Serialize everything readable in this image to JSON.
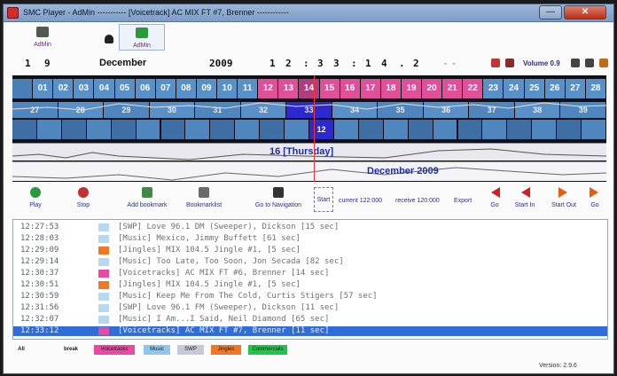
{
  "window": {
    "title": "SMC Player - AdMin ----------- [Voicetrack] AC MIX FT #7, Brenner ------------",
    "close_label": "✕",
    "minimize_label": "—"
  },
  "tabs": [
    {
      "label": "AdMin",
      "active": false
    },
    {
      "label": "AdMin",
      "active": true
    }
  ],
  "datetime": {
    "day": "1",
    "dayb": "9",
    "month": "December",
    "year": "2009",
    "time_parts": [
      "1",
      "2",
      ":",
      "3",
      "3",
      ":",
      "1",
      "4",
      ".",
      "2"
    ],
    "dashes": "- -",
    "volume_label": "Volume 0.9"
  },
  "timeline": {
    "days": [
      {
        "n": "",
        "color": "#4a7fb5"
      },
      {
        "n": "01",
        "color": "#5a90c8"
      },
      {
        "n": "02",
        "color": "#5a90c8"
      },
      {
        "n": "03",
        "color": "#5a90c8"
      },
      {
        "n": "04",
        "color": "#5a90c8"
      },
      {
        "n": "05",
        "color": "#5a90c8"
      },
      {
        "n": "06",
        "color": "#5a90c8"
      },
      {
        "n": "07",
        "color": "#5a90c8"
      },
      {
        "n": "08",
        "color": "#5a90c8"
      },
      {
        "n": "09",
        "color": "#5a90c8"
      },
      {
        "n": "10",
        "color": "#5a90c8"
      },
      {
        "n": "11",
        "color": "#5a90c8"
      },
      {
        "n": "12",
        "color": "#e0509a"
      },
      {
        "n": "13",
        "color": "#e0509a"
      },
      {
        "n": "14",
        "color": "#b03d80"
      },
      {
        "n": "15",
        "color": "#e0509a"
      },
      {
        "n": "16",
        "color": "#e0509a"
      },
      {
        "n": "17",
        "color": "#e0509a"
      },
      {
        "n": "18",
        "color": "#e0509a"
      },
      {
        "n": "19",
        "color": "#e0509a"
      },
      {
        "n": "20",
        "color": "#e0509a"
      },
      {
        "n": "21",
        "color": "#e0509a"
      },
      {
        "n": "22",
        "color": "#e0509a"
      },
      {
        "n": "23",
        "color": "#5a90c8"
      },
      {
        "n": "24",
        "color": "#5a90c8"
      },
      {
        "n": "25",
        "color": "#5a90c8"
      },
      {
        "n": "26",
        "color": "#5a90c8"
      },
      {
        "n": "27",
        "color": "#5a90c8"
      },
      {
        "n": "28",
        "color": "#5a90c8"
      }
    ],
    "hours": [
      "27",
      "28",
      "29",
      "30",
      "31",
      "32",
      "33",
      "34",
      "35",
      "36",
      "37",
      "38",
      "39"
    ],
    "current_hour": "33",
    "minutes": [
      "12"
    ],
    "day_label": "16 [Thursday]",
    "month_label": "December 2009"
  },
  "controls": {
    "play": "Play",
    "stop": "Stop",
    "add_bookmark": "Add bookmark",
    "bookmarklist": "Bookmarklist",
    "go_to_navigation": "Go to Navigation",
    "start": "Start",
    "current": "current 122:000",
    "receive": "receive 120:000",
    "export": "Export",
    "go": "Go",
    "start_in": "Start In",
    "start_out": "Start Out",
    "go_out": "Go"
  },
  "log": [
    {
      "time": "12:27:53",
      "color": "#b8d8ee",
      "text": "[SWP] Love 96.1 DM (Sweeper), Dickson [15 sec]"
    },
    {
      "time": "12:28:03",
      "color": "#b8d8ee",
      "text": "[Music] Mexico, Jimmy Buffett [61 sec]"
    },
    {
      "time": "12:29:09",
      "color": "#f07822",
      "text": "[Jingles] MIX 104.5 Jingle #1,    [5 sec]"
    },
    {
      "time": "12:29:14",
      "color": "#b8d8ee",
      "text": "[Music] Too Late, Too Soon, Jon Secada [82 sec]"
    },
    {
      "time": "12:30:37",
      "color": "#e84aa2",
      "text": "[Voicetracks] AC MIX FT #6, Brenner [14 sec]"
    },
    {
      "time": "12:30:51",
      "color": "#f07822",
      "text": "[Jingles] MIX 104.5 Jingle #1,    [5 sec]"
    },
    {
      "time": "12:30:59",
      "color": "#b8d8ee",
      "text": "[Music] Keep Me From The Cold, Curtis Stigers [57 sec]"
    },
    {
      "time": "12:31:56",
      "color": "#b8d8ee",
      "text": "[SWP] Love 96.1 FM (Sweeper), Dickson [11 sec]"
    },
    {
      "time": "12:32:07",
      "color": "#b8d8ee",
      "text": "[Music] I Am...I Said, Neil Diamond [65 sec]"
    },
    {
      "time": "12:33:12",
      "color": "#e84aa2",
      "text": "[Voicetracks] AC MIX FT #7, Brenner [11 sec]",
      "selected": true
    }
  ],
  "legend": [
    {
      "label": "All",
      "color": ""
    },
    {
      "label": "break",
      "color": ""
    },
    {
      "label": "Voicetracks",
      "color": "#e84aa2"
    },
    {
      "label": "Music",
      "color": "#8fc6ec"
    },
    {
      "label": "SWP",
      "color": "#c8c8d8"
    },
    {
      "label": "Jingles",
      "color": "#f07822"
    },
    {
      "label": "Commercials",
      "color": "#22c44a"
    }
  ],
  "version": "Version: 2.9.6"
}
